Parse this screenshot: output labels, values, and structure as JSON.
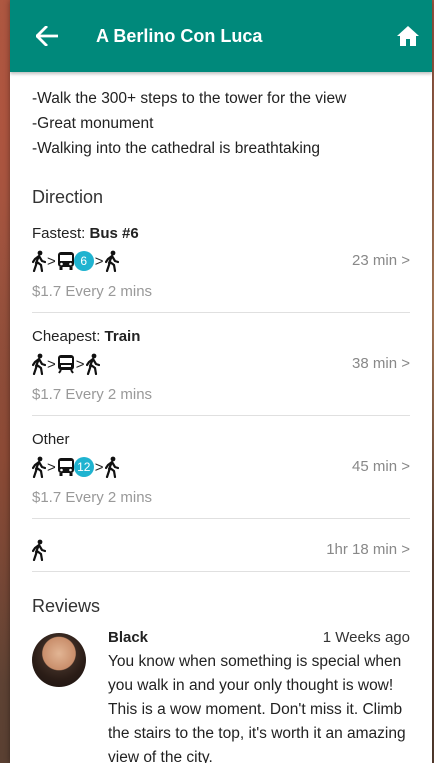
{
  "header": {
    "title": "A Berlino Con Luca"
  },
  "highlights": [
    "-Walk the 300+ steps to the tower for the view",
    "-Great monument",
    "-Walking into the cathedral is breathtaking"
  ],
  "direction": {
    "title": "Direction",
    "routes": [
      {
        "label_prefix": "Fastest: ",
        "label_bold": "Bus #6",
        "badge": "6",
        "time": "23 min >",
        "price": "$1.7 Every 2 mins"
      },
      {
        "label_prefix": "Cheapest: ",
        "label_bold": "Train",
        "time": "38 min >",
        "price": "$1.7 Every 2 mins"
      },
      {
        "label_prefix": "Other",
        "badge": "12",
        "time": "45 min >",
        "price": "$1.7 Every 2 mins"
      }
    ],
    "walk": {
      "time": "1hr 18 min >"
    }
  },
  "reviews": {
    "title": "Reviews",
    "items": [
      {
        "name": "Black",
        "date": "1 Weeks ago",
        "text": "You know when something is special when you walk in and your only thought is wow! This is a wow moment. Don't miss it. Climb the stairs to the top, it's worth it an amazing view of the city."
      }
    ]
  },
  "colors": {
    "appbar": "#00897b",
    "badge": "#1fb3d0"
  }
}
